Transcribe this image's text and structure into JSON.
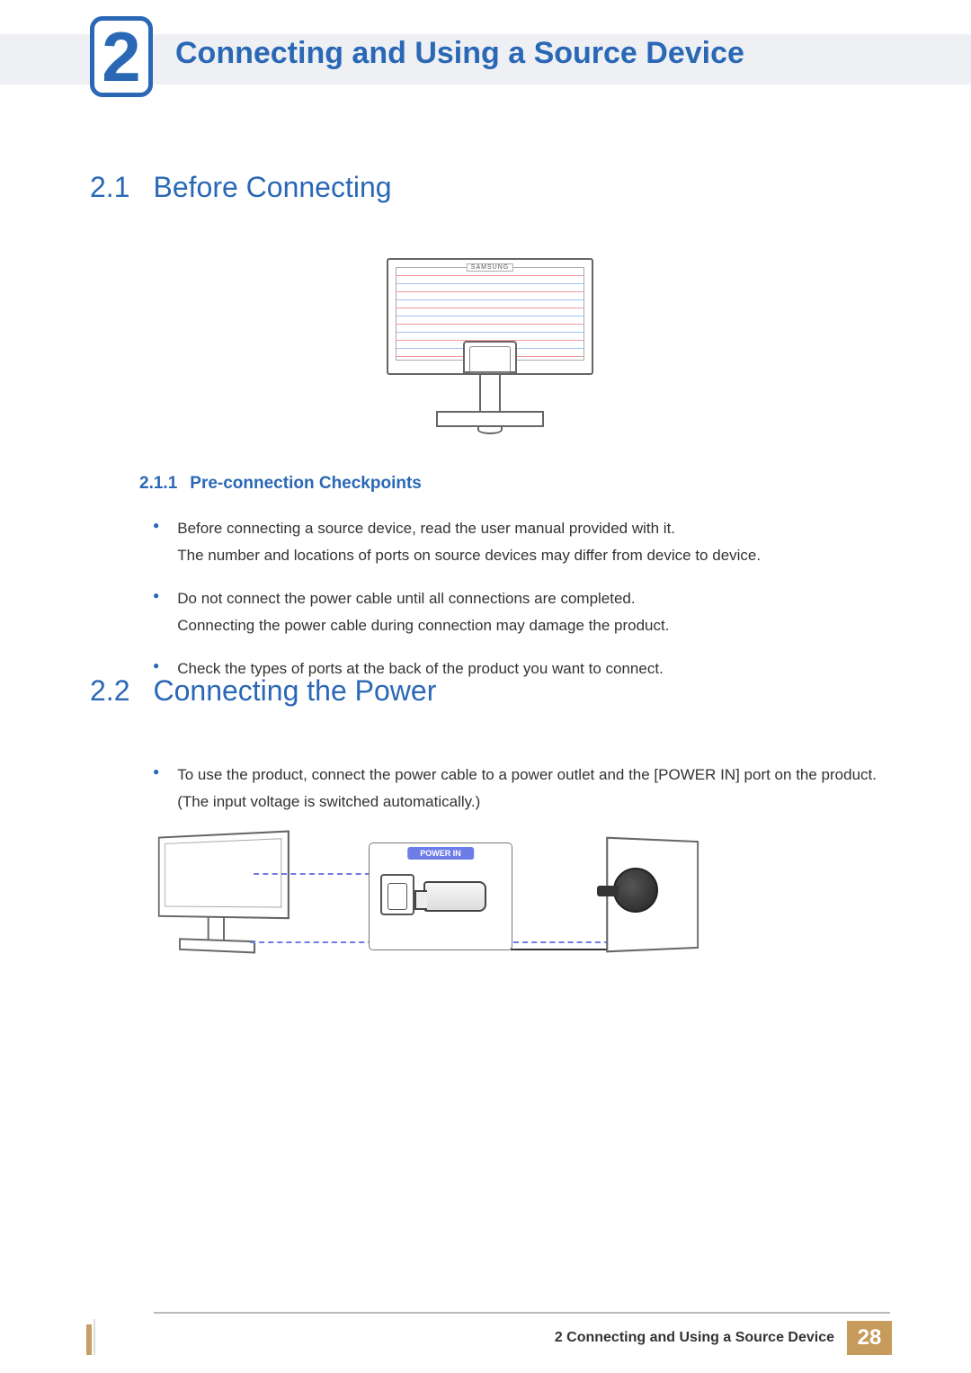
{
  "chapter": {
    "number": "2",
    "title": "Connecting and Using a Source Device"
  },
  "section21": {
    "number": "2.1",
    "title": "Before Connecting",
    "illustration_brand": "SAMSUNG",
    "sub": {
      "number": "2.1.1",
      "title": "Pre-connection Checkpoints"
    },
    "bullets": [
      "Before connecting a source device, read the user manual provided with it.\nThe number and locations of ports on source devices may differ from device to device.",
      "Do not connect the power cable until all connections are completed.\nConnecting the power cable during connection may damage the product.",
      "Check the types of ports at the back of the product you want to connect."
    ]
  },
  "section22": {
    "number": "2.2",
    "title": "Connecting the Power",
    "bullets": [
      "To use the product, connect the power cable to a power outlet and the [POWER IN] port on the product.(The input voltage is switched automatically.)"
    ],
    "zoom_label": "POWER IN"
  },
  "footer": {
    "chapter_ref": "2 Connecting and Using a Source Device",
    "page": "28"
  }
}
